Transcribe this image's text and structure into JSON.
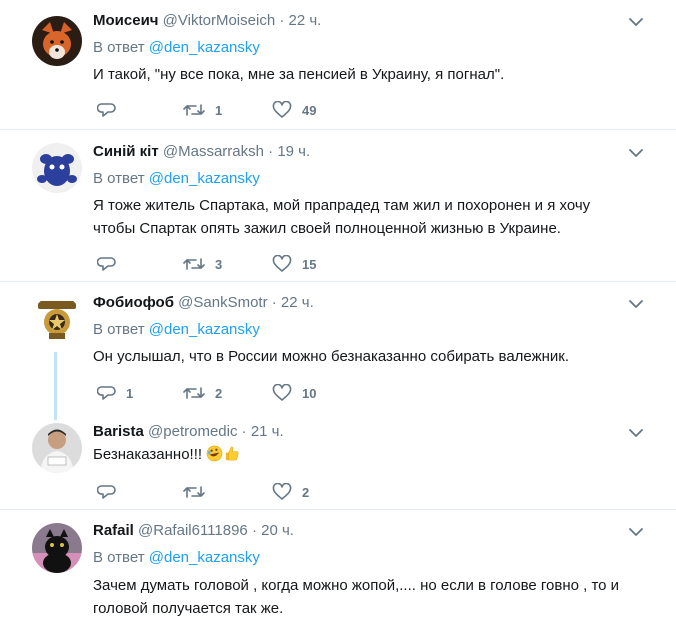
{
  "tweets": [
    {
      "name": "Моисеич",
      "handle": "@ViktorMoiseich",
      "dot": "·",
      "time": "22 ч.",
      "reply_prefix": "В ответ",
      "reply_to": "@den_kazansky",
      "lines": [
        "И такой, \"ну все пока, мне за пенсией в Украину, я погнал\"."
      ],
      "replies": "",
      "retweets": "1",
      "likes": "49"
    },
    {
      "name": "Синій кіт",
      "handle": "@Massarraksh",
      "dot": "·",
      "time": "19 ч.",
      "reply_prefix": "В ответ",
      "reply_to": "@den_kazansky",
      "lines": [
        "Я тоже житель Спартака, мой прапрадед там жил и похоронен и я хочу",
        "чтобы Спартак опять зажил своей полноценной жизнью в Украине."
      ],
      "replies": "",
      "retweets": "3",
      "likes": "15"
    },
    {
      "name": "Фобиофоб",
      "handle": "@SankSmotr",
      "dot": "·",
      "time": "22 ч.",
      "reply_prefix": "В ответ",
      "reply_to": "@den_kazansky",
      "lines": [
        "Он услышал, что в России можно безнаказанно собирать валежник."
      ],
      "replies": "1",
      "retweets": "2",
      "likes": "10"
    },
    {
      "name": "Barista",
      "handle": "@petromedic",
      "dot": "·",
      "time": "21 ч.",
      "lines": [
        "Безнаказанно!!!"
      ],
      "replies": "",
      "retweets": "",
      "likes": "2"
    },
    {
      "name": "Rafail",
      "handle": "@Rafail6111896",
      "dot": "·",
      "time": "20 ч.",
      "reply_prefix": "В ответ",
      "reply_to": "@den_kazansky",
      "lines": [
        "Зачем думать головой , когда можно жопой,.... но если в голове говно , то и",
        "головой получается так же."
      ]
    }
  ],
  "icons": {
    "reply": "reply-icon",
    "retweet": "retweet-icon",
    "like": "heart-icon",
    "menu": "chevron-down-icon",
    "emoji": [
      "rolling-laughing-emoji",
      "thumbs-up-emoji"
    ]
  },
  "colors": {
    "link": "#1da1f2",
    "muted": "#657786",
    "divider": "#e6ecf0",
    "thread_line": "#c4e2f7"
  }
}
